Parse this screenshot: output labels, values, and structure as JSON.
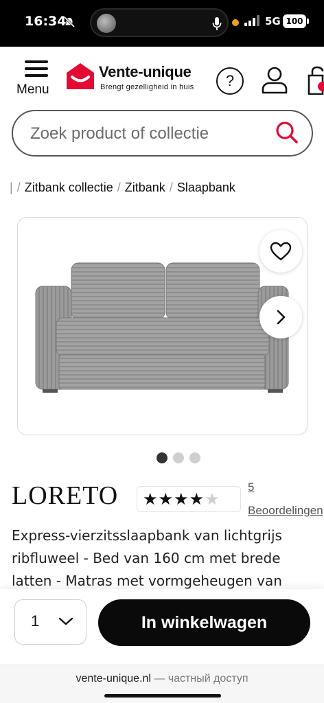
{
  "status_bar": {
    "time": "16:34",
    "network": "5G",
    "battery": "100"
  },
  "header": {
    "menu_label": "Menu",
    "brand_name": "Vente-unique",
    "brand_tagline": "Brengt gezelligheid in huis",
    "help_symbol": "?"
  },
  "search": {
    "placeholder": "Zoek product of collectie"
  },
  "breadcrumb": {
    "items": [
      "Zitbank collectie",
      "Zitbank",
      "Slaapbank"
    ]
  },
  "product": {
    "title": "LORETO",
    "rating_stars": 4,
    "rating_max": 5,
    "review_count": "5",
    "review_label": "Beoordelingen",
    "description": "Express-vierzitsslaapbank van lichtgrijs ribfluweel - Bed van 160 cm met brede latten - Matras met vormgeheugen van",
    "gallery_dots": 3,
    "gallery_active": 0
  },
  "cart": {
    "quantity": "1",
    "add_label": "In winkelwagen"
  },
  "url_bar": {
    "domain": "vente-unique.nl",
    "separator": " — ",
    "note": "частный доступ"
  },
  "colors": {
    "brand_red": "#e30b35",
    "button_black": "#0a0a0a"
  },
  "icons": [
    "mute-icon",
    "mic-icon",
    "signal-icon",
    "menu-icon",
    "help-icon",
    "account-icon",
    "cart-icon",
    "search-icon",
    "heart-icon",
    "chevron-right-icon",
    "chevron-down-icon",
    "star-icon"
  ]
}
